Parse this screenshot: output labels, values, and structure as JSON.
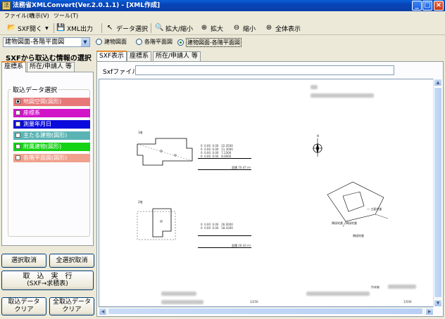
{
  "window": {
    "title": "法務省XMLConvert(Ver.2.0.1.1) - [XML作成]",
    "app_icon": "app-icon"
  },
  "menu": {
    "file": "ファイル(F)",
    "view": "表示(V)",
    "tools": "ツール(T)"
  },
  "toolbar": {
    "sxf_open": "SXF開く",
    "xml_out": "XML出力",
    "data_select": "データ選択",
    "zoom_toggle": "拡大/縮小",
    "zoom_in": "拡大",
    "zoom_out": "縮小",
    "show_all": "全体表示"
  },
  "selector": {
    "combo_value": "建物図面-各階平面図",
    "radio_building": "建物図面",
    "radio_floor": "各階平面図",
    "radio_both": "建物図面-各階平面図",
    "selected": "radio_both"
  },
  "left": {
    "heading": "SXFから取込む情報の選択",
    "tab_coords": "座標系",
    "tab_location": "所在/申請人 等",
    "group_title": "取込データ選択",
    "options": [
      {
        "label": "地図空間(図形)",
        "color": "#e87878",
        "checked": true
      },
      {
        "label": "座標系",
        "color": "#d214c8",
        "checked": false
      },
      {
        "label": "測量年月日",
        "color": "#0a0adc",
        "checked": false
      },
      {
        "label": "主たる建物(図形)",
        "color": "#5ab4b4",
        "checked": false
      },
      {
        "label": "附属建物(図形)",
        "color": "#14d214",
        "checked": false
      },
      {
        "label": "各階平面図(図形)",
        "color": "#f0a08c",
        "checked": false
      }
    ],
    "btn_deselect": "選択取消",
    "btn_deselect_all": "全選択取消",
    "btn_import_line1": "取　込　実　行",
    "btn_import_line2": "(SXF→求積表)",
    "btn_clear_line1": "取込データ",
    "btn_clear_line2": "クリア",
    "btn_clear_all_line1": "全取込データ",
    "btn_clear_all_line2": "クリア"
  },
  "right": {
    "tab_sxf": "SXF表示",
    "tab_coords": "座標系",
    "tab_location": "所在/申請人 等",
    "sxf_file_label": "Sxfファイル",
    "sxf_file_value": ""
  },
  "drawing": {
    "label_building1": "1階",
    "label_building2": "2階",
    "floor_total1": "面積  70.47 m²",
    "floor_total2": "面積  26.43 m²",
    "scale_left": "1/250",
    "scale_right": "1/500",
    "author_label": "作成者",
    "north": "N"
  }
}
